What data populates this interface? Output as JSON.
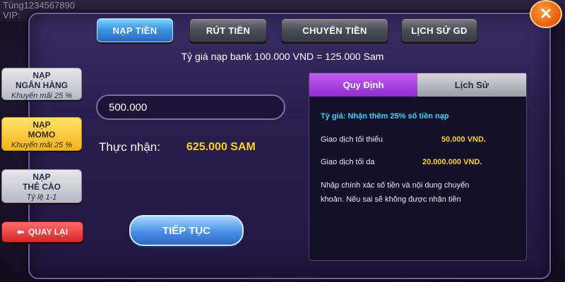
{
  "background": {
    "user": "Tùng1234567890",
    "vip": "VIP:"
  },
  "tabs": [
    {
      "label": "NẠP TIỀN",
      "active": true
    },
    {
      "label": "RÚT TIỀN",
      "active": false
    },
    {
      "label": "CHUYỂN TIỀN",
      "active": false
    },
    {
      "label": "LỊCH SỬ GD",
      "active": false
    }
  ],
  "rate_text": "Tỷ giá nạp bank 100.000 VND = 125.000 Sam",
  "side_menu": [
    {
      "title_line1": "NẠP",
      "title_line2": "NGÂN HÀNG",
      "sub": "Khuyến mãi 25 %",
      "active": false
    },
    {
      "title_line1": "NẠP",
      "title_line2": "MOMO",
      "sub": "Khuyến mãi 25 %",
      "active": true
    },
    {
      "title_line1": "NẠP",
      "title_line2": "THẺ CÀO",
      "sub": "Tỷ lệ 1-1",
      "active": false
    }
  ],
  "back_button": "QUAY LẠI",
  "amount_input": {
    "value": "500.000"
  },
  "receive": {
    "label": "Thực nhận:",
    "value": "625.000 SAM"
  },
  "continue_button": "TIẾP TỤC",
  "info_tabs": {
    "rules": "Quy Định",
    "history": "Lịch Sử"
  },
  "info": {
    "rate_bonus": "Tỷ giá: Nhận thêm 25% số tiền nạp",
    "min_label": "Giao dịch tối thiểu",
    "min_value": "50.000 VND.",
    "max_label": "Giao dịch tối da",
    "max_value": "20.000.000 VND.",
    "note_line1": "Nhập chính xác số tiền và nội dung chuyển",
    "note_line2": "khoản. Nếu sai sẽ không được nhận tiền"
  },
  "close_icon": "close-icon"
}
